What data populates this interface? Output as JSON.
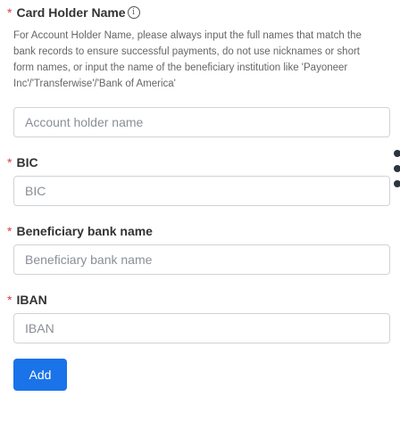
{
  "fields": {
    "card_holder": {
      "label": "Card Holder Name",
      "required_mark": "*",
      "help_text": "For Account Holder Name, please always input the full names that match the bank records to ensure successful payments, do not use nicknames or short form names, or input the name of the beneficiary institution like 'Payoneer Inc'/'Transferwise'/'Bank of America'",
      "placeholder": "Account holder name",
      "value": ""
    },
    "bic": {
      "label": "BIC",
      "required_mark": "*",
      "placeholder": "BIC",
      "value": ""
    },
    "bank_name": {
      "label": "Beneficiary bank name",
      "required_mark": "*",
      "placeholder": "Beneficiary bank name",
      "value": ""
    },
    "iban": {
      "label": "IBAN",
      "required_mark": "*",
      "placeholder": "IBAN",
      "value": ""
    }
  },
  "info_icon_glyph": "i",
  "add_button_label": "Add",
  "colors": {
    "primary": "#1a73e8",
    "required": "#e0383e",
    "border": "#cfd3d8"
  },
  "icons": {
    "info": "info-circle-icon",
    "more": "vertical-dots-icon"
  }
}
